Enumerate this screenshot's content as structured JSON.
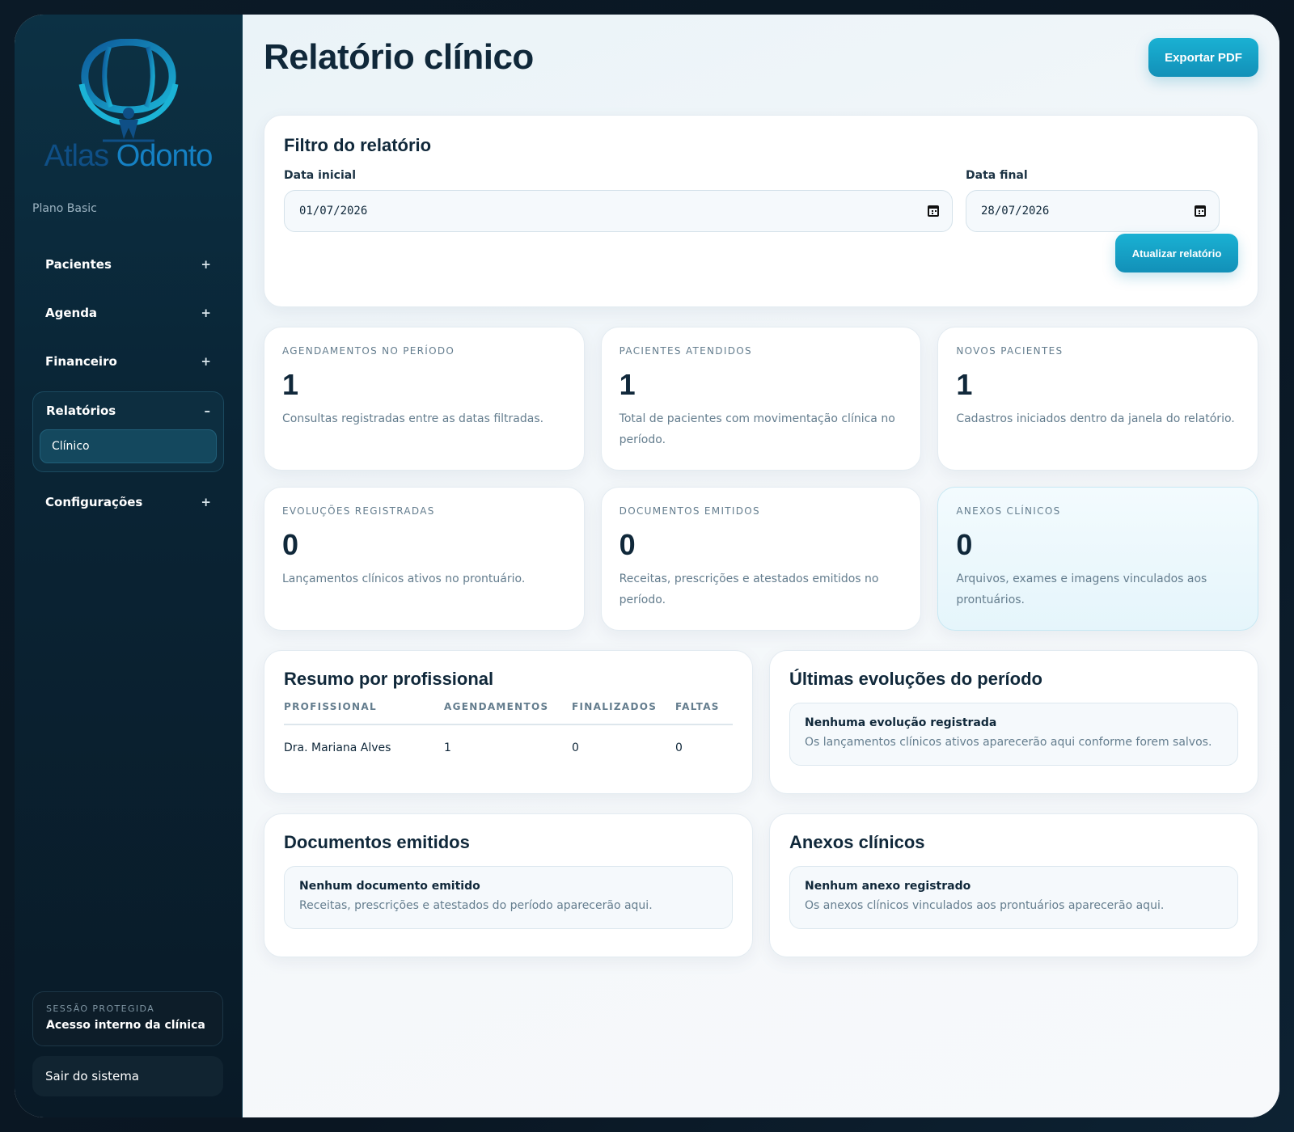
{
  "brand": {
    "name_part1": "Atlas",
    "name_part2": "Odonto",
    "plan": "Plano Basic"
  },
  "nav": {
    "items": [
      {
        "label": "Pacientes",
        "toggle": "+"
      },
      {
        "label": "Agenda",
        "toggle": "+"
      },
      {
        "label": "Financeiro",
        "toggle": "+"
      },
      {
        "label": "Relatórios",
        "toggle": "–",
        "expanded": true,
        "children": [
          {
            "label": "Clínico",
            "active": true
          }
        ]
      },
      {
        "label": "Configurações",
        "toggle": "+"
      }
    ]
  },
  "session": {
    "label": "SESSÃO PROTEGIDA",
    "value": "Acesso interno da clínica"
  },
  "logout_label": "Sair do sistema",
  "header": {
    "title": "Relatório clínico",
    "export_label": "Exportar PDF"
  },
  "filter": {
    "title": "Filtro do relatório",
    "start_label": "Data inicial",
    "start_value": "01/07/2026",
    "end_label": "Data final",
    "end_value": "28/07/2026",
    "refresh_label": "Atualizar relatório"
  },
  "stats": [
    {
      "label": "AGENDAMENTOS NO PERÍODO",
      "value": "1",
      "desc": "Consultas registradas entre as datas filtradas."
    },
    {
      "label": "PACIENTES ATENDIDOS",
      "value": "1",
      "desc": "Total de pacientes com movimentação clínica no período."
    },
    {
      "label": "NOVOS PACIENTES",
      "value": "1",
      "desc": "Cadastros iniciados dentro da janela do relatório."
    },
    {
      "label": "EVOLUÇÕES REGISTRADAS",
      "value": "0",
      "desc": "Lançamentos clínicos ativos no prontuário."
    },
    {
      "label": "DOCUMENTOS EMITIDOS",
      "value": "0",
      "desc": "Receitas, prescrições e atestados emitidos no período."
    },
    {
      "label": "ANEXOS CLÍNICOS",
      "value": "0",
      "desc": "Arquivos, exames e imagens vinculados aos prontuários."
    }
  ],
  "summary": {
    "title": "Resumo por profissional",
    "columns": [
      "PROFISSIONAL",
      "AGENDAMENTOS",
      "FINALIZADOS",
      "FALTAS"
    ],
    "rows": [
      [
        "Dra. Mariana Alves",
        "1",
        "0",
        "0"
      ]
    ]
  },
  "evolutions": {
    "title": "Últimas evoluções do período",
    "empty_title": "Nenhuma evolução registrada",
    "empty_desc": "Os lançamentos clínicos ativos aparecerão aqui conforme forem salvos."
  },
  "documents": {
    "title": "Documentos emitidos",
    "empty_title": "Nenhum documento emitido",
    "empty_desc": "Receitas, prescrições e atestados do período aparecerão aqui."
  },
  "attachments": {
    "title": "Anexos clínicos",
    "empty_title": "Nenhum anexo registrado",
    "empty_desc": "Os anexos clínicos vinculados aos prontuários aparecerão aqui."
  },
  "colors": {
    "accent": "#1ab1d3",
    "sidebar_bg": "#0a2536",
    "title": "#10283a",
    "muted": "#647d8e"
  },
  "icons": {
    "logo": "globe-tooth-atlas-logo",
    "calendar": "calendar-icon"
  }
}
